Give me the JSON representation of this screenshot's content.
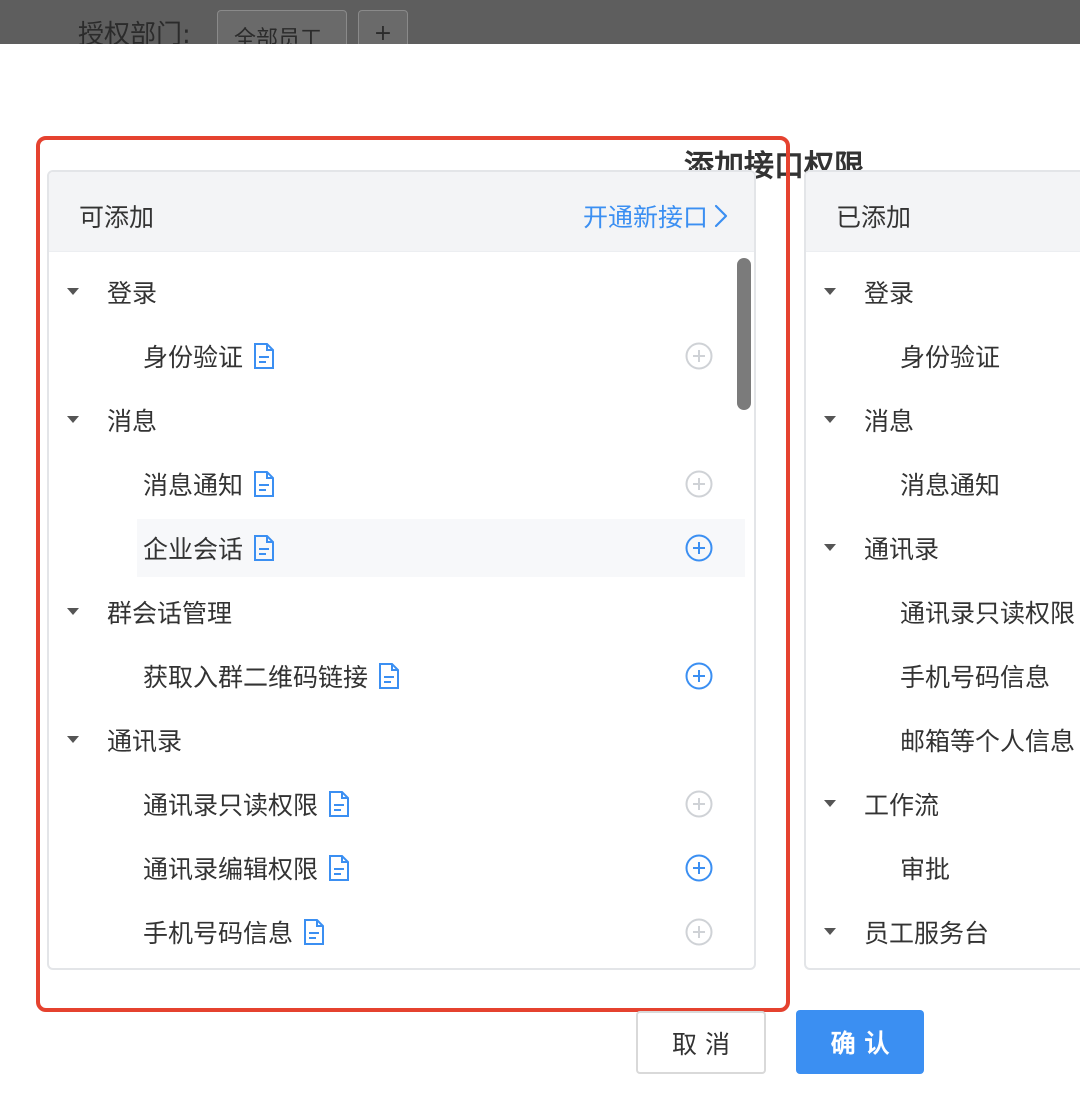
{
  "backdrop": {
    "label": "授权部门:",
    "chip_all": "全部员工",
    "chip_add": "+"
  },
  "modal": {
    "title": "添加接口权限",
    "cancel_label": "取 消",
    "confirm_label": "确 认",
    "accent_color": "#3b8ff2",
    "highlight_color": "#e5422f"
  },
  "available": {
    "title": "可添加",
    "open_link": "开通新接口",
    "groups": [
      {
        "label": "登录",
        "items": [
          {
            "label": "身份验证",
            "add_active": false
          }
        ]
      },
      {
        "label": "消息",
        "items": [
          {
            "label": "消息通知",
            "add_active": false
          },
          {
            "label": "企业会话",
            "add_active": true
          }
        ]
      },
      {
        "label": "群会话管理",
        "items": [
          {
            "label": "获取入群二维码链接",
            "add_active": true
          }
        ]
      },
      {
        "label": "通讯录",
        "items": [
          {
            "label": "通讯录只读权限",
            "add_active": false
          },
          {
            "label": "通讯录编辑权限",
            "add_active": true
          },
          {
            "label": "手机号码信息",
            "add_active": false
          }
        ]
      }
    ]
  },
  "added": {
    "title": "已添加",
    "groups": [
      {
        "label": "登录",
        "items": [
          "身份验证"
        ]
      },
      {
        "label": "消息",
        "items": [
          "消息通知"
        ]
      },
      {
        "label": "通讯录",
        "items": [
          "通讯录只读权限",
          "手机号码信息",
          "邮箱等个人信息"
        ]
      },
      {
        "label": "工作流",
        "items": [
          "审批"
        ]
      },
      {
        "label": "员工服务台",
        "items": []
      }
    ]
  },
  "icons": {
    "caret": "caret-down-icon",
    "doc": "document-icon",
    "add": "plus-circle-icon",
    "open": "chevron-right-icon"
  }
}
